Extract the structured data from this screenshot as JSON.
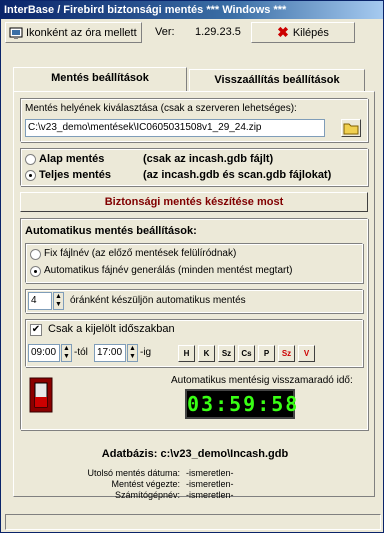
{
  "window": {
    "title": "InterBase / Firebird biztonsági mentés *** Windows ***"
  },
  "toolbar": {
    "tray_button": "Ikonként az óra mellett",
    "version_label": "Ver:",
    "version_value": "1.29.23.5",
    "exit_button": "Kilépés"
  },
  "tabs": [
    {
      "label": "Mentés beállítások"
    },
    {
      "label": "Visszaállítás beállítások"
    }
  ],
  "backup": {
    "location_label": "Mentés helyének kiválasztása  (csak a szerveren lehetséges):",
    "location_value": "C:\\v23_demo\\mentések\\IC0605031508v1_29_24.zip",
    "modes": [
      {
        "label": "Alap mentés",
        "desc": "(csak az incash.gdb fájlt)",
        "selected": false
      },
      {
        "label": "Teljes mentés",
        "desc": "(az incash.gdb és scan.gdb fájlokat)",
        "selected": true
      }
    ],
    "create_button": "Biztonsági mentés készítése most"
  },
  "auto": {
    "title": "Automatikus mentés beállítások:",
    "options": [
      {
        "label": "Fix fájlnév (az előző mentések felülíródnak)",
        "selected": false
      },
      {
        "label": "Automatikus fájnév generálás (minden mentést megtart)",
        "selected": true
      }
    ],
    "hours_value": "4",
    "hours_label": "óránként készüljön automatikus mentés",
    "window_checkbox_label": "Csak a kijelölt időszakban",
    "window_checked": true,
    "from_value": "09:00",
    "from_suffix": "-tól",
    "to_value": "17:00",
    "to_suffix": "-ig",
    "days": [
      "H",
      "K",
      "Sz",
      "Cs",
      "P",
      "Sz",
      "V"
    ],
    "countdown_label": "Automatikus mentésig visszamaradó idő:",
    "countdown_value": "03:59:58"
  },
  "database": {
    "label": "Adatbázis: c:\\v23_demo\\Incash.gdb"
  },
  "info": {
    "last_date_label": "Utolsó mentés dátuma:",
    "last_date_value": "-ismeretlen-",
    "done_label": "Mentést végezte:",
    "done_value": "-ismeretlen-",
    "computer_label": "Számítógépnév:",
    "computer_value": "-ismeretlen-"
  },
  "colors": {
    "title_bg": "#0a246a",
    "create_text": "#800000",
    "exit_icon": "#cc0000",
    "digital": "#39ff14"
  }
}
